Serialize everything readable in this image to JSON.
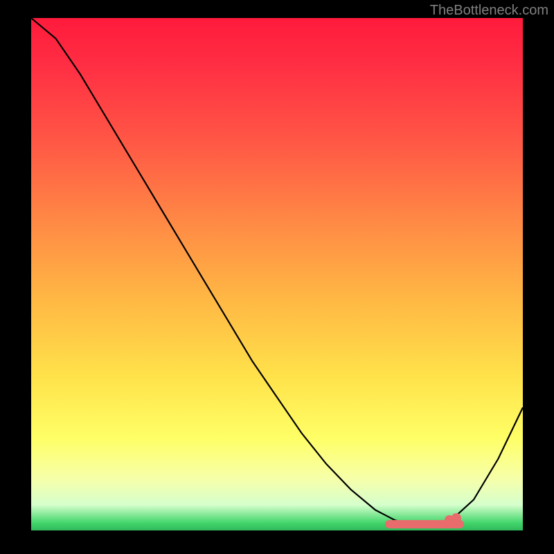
{
  "watermark": "TheBottleneck.com",
  "chart_data": {
    "type": "line",
    "title": "",
    "xlabel": "",
    "ylabel": "",
    "xlim": [
      0,
      100
    ],
    "ylim": [
      0,
      100
    ],
    "x": [
      0,
      5,
      10,
      15,
      20,
      25,
      30,
      35,
      40,
      45,
      50,
      55,
      60,
      65,
      70,
      72,
      74,
      76,
      78,
      80,
      82,
      84,
      86,
      90,
      95,
      100
    ],
    "y": [
      100,
      96,
      89,
      81,
      73,
      65,
      57,
      49,
      41,
      33,
      26,
      19,
      13,
      8,
      4,
      3,
      2,
      1.5,
      1.2,
      1.0,
      1.2,
      1.5,
      2.5,
      6,
      14,
      24
    ],
    "highlight_range_x": [
      72,
      88
    ],
    "highlight_y": 1.2,
    "markers": [
      {
        "x": 85,
        "y": 2.0
      },
      {
        "x": 86.5,
        "y": 2.5
      }
    ],
    "gradient_stops": [
      {
        "offset": 0,
        "color": "#ff1a3c"
      },
      {
        "offset": 0.1,
        "color": "#ff3044"
      },
      {
        "offset": 0.25,
        "color": "#ff5a45"
      },
      {
        "offset": 0.4,
        "color": "#ff8a45"
      },
      {
        "offset": 0.55,
        "color": "#ffb844"
      },
      {
        "offset": 0.7,
        "color": "#ffe24a"
      },
      {
        "offset": 0.82,
        "color": "#ffff66"
      },
      {
        "offset": 0.9,
        "color": "#f6ffaa"
      },
      {
        "offset": 0.95,
        "color": "#d6ffcc"
      },
      {
        "offset": 0.985,
        "color": "#43d66c"
      },
      {
        "offset": 1.0,
        "color": "#2fb85a"
      }
    ]
  }
}
